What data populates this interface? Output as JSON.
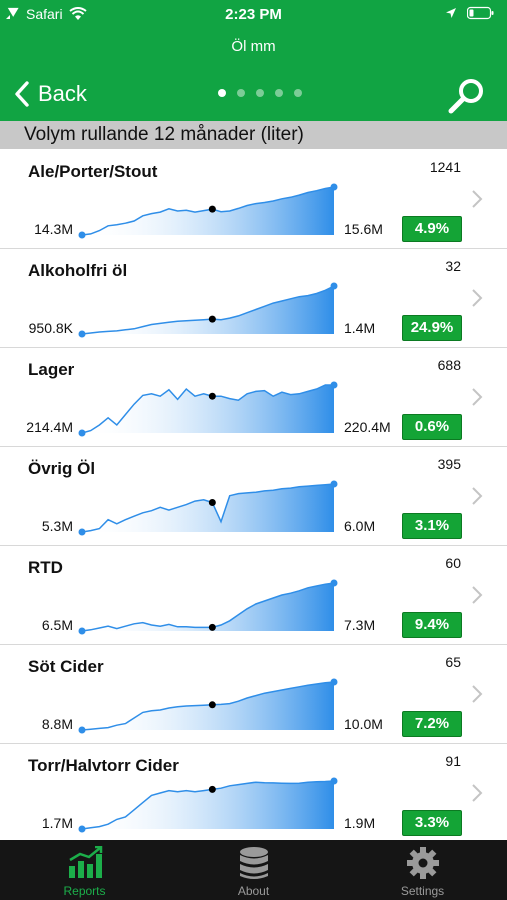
{
  "status_bar": {
    "carrier": "Safari",
    "time": "2:23 PM"
  },
  "nav": {
    "subtitle": "Öl mm",
    "back_label": "Back",
    "page_count": 5,
    "active_page": 0
  },
  "section_title": "Volym rullande 12 månader (liter)",
  "rows": [
    {
      "name": "Ale/Porter/Stout",
      "count": "1241",
      "min": "14.3M",
      "max": "15.6M",
      "change": "4.9%",
      "trend": [
        14.3,
        14.33,
        14.42,
        14.55,
        14.58,
        14.62,
        14.68,
        14.82,
        14.88,
        14.92,
        15.01,
        14.95,
        14.97,
        14.92,
        14.96,
        15.0,
        14.93,
        14.95,
        15.02,
        15.1,
        15.15,
        15.18,
        15.22,
        15.28,
        15.32,
        15.38,
        15.45,
        15.5,
        15.56,
        15.6
      ],
      "marker": 15
    },
    {
      "name": "Alkoholfri öl",
      "count": "32",
      "min": "950.8K",
      "max": "1.4M",
      "change": "24.9%",
      "trend": [
        0.951,
        0.96,
        0.97,
        0.975,
        0.98,
        0.99,
        1.0,
        1.02,
        1.04,
        1.05,
        1.06,
        1.07,
        1.075,
        1.08,
        1.085,
        1.09,
        1.085,
        1.1,
        1.12,
        1.15,
        1.18,
        1.21,
        1.24,
        1.26,
        1.28,
        1.3,
        1.31,
        1.33,
        1.36,
        1.4
      ],
      "marker": 15
    },
    {
      "name": "Lager",
      "count": "688",
      "min": "214.4M",
      "max": "220.4M",
      "change": "0.6%",
      "trend": [
        214.4,
        214.7,
        215.4,
        216.3,
        215.4,
        216.7,
        218.0,
        219.1,
        219.3,
        219.0,
        219.8,
        218.6,
        219.9,
        219.0,
        219.3,
        219.0,
        219.0,
        218.7,
        218.5,
        219.3,
        219.6,
        219.7,
        219.0,
        219.5,
        219.2,
        219.3,
        219.6,
        219.9,
        220.4,
        220.4
      ],
      "marker": 15
    },
    {
      "name": "Övrig Öl",
      "count": "395",
      "min": "5.3M",
      "max": "6.0M",
      "change": "3.1%",
      "trend": [
        5.3,
        5.32,
        5.35,
        5.48,
        5.42,
        5.48,
        5.53,
        5.58,
        5.61,
        5.66,
        5.62,
        5.66,
        5.7,
        5.75,
        5.77,
        5.73,
        5.45,
        5.83,
        5.86,
        5.87,
        5.88,
        5.9,
        5.91,
        5.93,
        5.94,
        5.96,
        5.97,
        5.98,
        5.99,
        6.0
      ],
      "marker": 15
    },
    {
      "name": "RTD",
      "count": "60",
      "min": "6.5M",
      "max": "7.3M",
      "change": "9.4%",
      "trend": [
        6.5,
        6.52,
        6.55,
        6.58,
        6.54,
        6.58,
        6.62,
        6.64,
        6.6,
        6.58,
        6.61,
        6.57,
        6.57,
        6.56,
        6.56,
        6.56,
        6.6,
        6.67,
        6.77,
        6.87,
        6.95,
        7.0,
        7.05,
        7.1,
        7.13,
        7.17,
        7.22,
        7.25,
        7.28,
        7.3
      ],
      "marker": 15
    },
    {
      "name": "Söt Cider",
      "count": "65",
      "min": "8.8M",
      "max": "10.0M",
      "change": "7.2%",
      "trend": [
        8.8,
        8.82,
        8.84,
        8.86,
        8.92,
        8.96,
        9.1,
        9.24,
        9.28,
        9.3,
        9.35,
        9.38,
        9.4,
        9.41,
        9.42,
        9.43,
        9.44,
        9.46,
        9.52,
        9.6,
        9.66,
        9.72,
        9.76,
        9.8,
        9.84,
        9.88,
        9.92,
        9.95,
        9.98,
        10.0
      ],
      "marker": 15
    },
    {
      "name": "Torr/Halvtorr Cider",
      "count": "91",
      "min": "1.7M",
      "max": "1.9M",
      "change": "3.3%",
      "trend": [
        1.7,
        1.705,
        1.71,
        1.72,
        1.74,
        1.75,
        1.78,
        1.81,
        1.84,
        1.85,
        1.86,
        1.855,
        1.86,
        1.855,
        1.86,
        1.865,
        1.87,
        1.88,
        1.885,
        1.89,
        1.895,
        1.893,
        1.892,
        1.891,
        1.89,
        1.891,
        1.895,
        1.897,
        1.898,
        1.9
      ],
      "marker": 15
    }
  ],
  "tabs": [
    {
      "label": "Reports",
      "icon": "chart-icon",
      "active": true
    },
    {
      "label": "About",
      "icon": "database-icon",
      "active": false
    },
    {
      "label": "Settings",
      "icon": "gear-icon",
      "active": false
    }
  ],
  "colors": {
    "brand_green": "#11a443",
    "badge_green": "#14a436",
    "trend_blue": "#2f8ee8"
  }
}
